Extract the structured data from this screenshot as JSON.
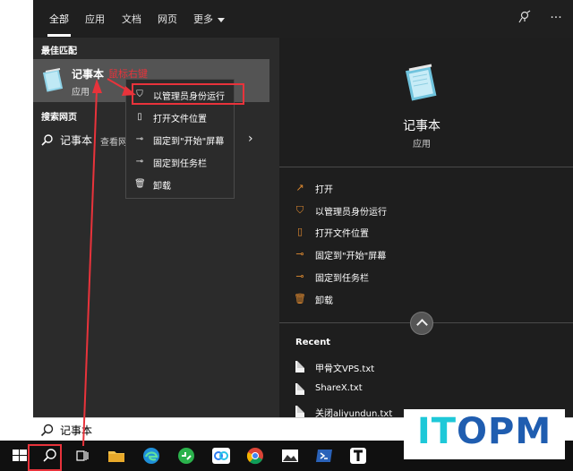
{
  "tabs": [
    {
      "label": "全部",
      "active": true
    },
    {
      "label": "应用"
    },
    {
      "label": "文档"
    },
    {
      "label": "网页"
    },
    {
      "label": "更多"
    }
  ],
  "left": {
    "best_match_title": "最佳匹配",
    "best_match": {
      "name": "记事本",
      "type": "应用"
    },
    "annotation": "鼠标右键",
    "web_title": "搜索网页",
    "web_result": {
      "text": "记事本",
      "subtext": "查看网"
    }
  },
  "context_menu": [
    {
      "label": "以管理员身份运行",
      "icon": "shield-icon"
    },
    {
      "label": "打开文件位置",
      "icon": "file-icon"
    },
    {
      "label": "固定到\"开始\"屏幕",
      "icon": "pin-icon"
    },
    {
      "label": "固定到任务栏",
      "icon": "pin-icon"
    },
    {
      "label": "卸载",
      "icon": "trash-icon"
    }
  ],
  "right": {
    "app_name": "记事本",
    "app_type": "应用",
    "actions": [
      {
        "label": "打开",
        "icon": "open-icon"
      },
      {
        "label": "以管理员身份运行",
        "icon": "shield-icon"
      },
      {
        "label": "打开文件位置",
        "icon": "file-icon"
      },
      {
        "label": "固定到\"开始\"屏幕",
        "icon": "pin-icon"
      },
      {
        "label": "固定到任务栏",
        "icon": "pin-icon"
      },
      {
        "label": "卸载",
        "icon": "trash-icon"
      }
    ],
    "recent_title": "Recent",
    "recent": [
      {
        "label": "甲骨文VPS.txt"
      },
      {
        "label": "ShareX.txt"
      },
      {
        "label": "关闭aliyundun.txt"
      }
    ]
  },
  "search": {
    "value": "记事本"
  },
  "watermark": "ITOPM",
  "colors": {
    "accent_orange": "#e08a30",
    "annotation_red": "#e8333b",
    "watermark_cyan": "#1ec8d8",
    "watermark_blue": "#1f5db0"
  }
}
